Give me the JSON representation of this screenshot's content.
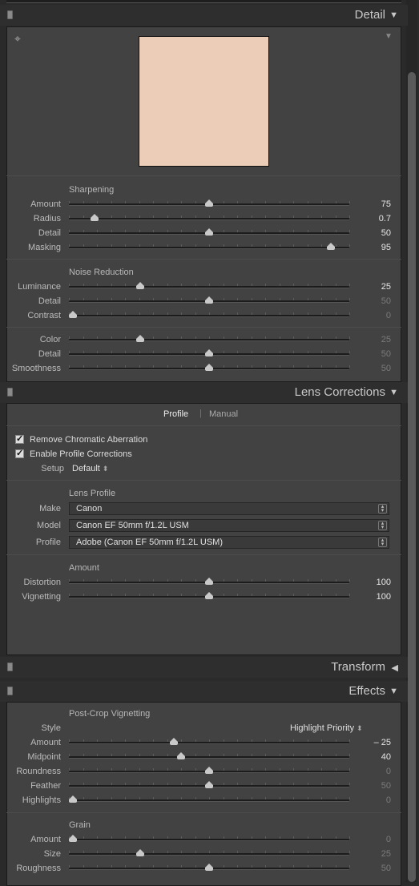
{
  "detail": {
    "title": "Detail",
    "sharpening": {
      "title": "Sharpening",
      "sliders": [
        {
          "label": "Amount",
          "value": "75",
          "pos": 0.5
        },
        {
          "label": "Radius",
          "value": "0.7",
          "pos": 0.09
        },
        {
          "label": "Detail",
          "value": "50",
          "pos": 0.5
        },
        {
          "label": "Masking",
          "value": "95",
          "pos": 0.935
        }
      ]
    },
    "noise": {
      "title": "Noise Reduction",
      "sliders": [
        {
          "label": "Luminance",
          "value": "25",
          "pos": 0.255,
          "dim": false
        },
        {
          "label": "Detail",
          "value": "50",
          "pos": 0.5,
          "dim": true
        },
        {
          "label": "Contrast",
          "value": "0",
          "pos": 0.015,
          "dim": true
        },
        {
          "label": "Color",
          "value": "25",
          "pos": 0.255,
          "dim": true
        },
        {
          "label": "Detail",
          "value": "50",
          "pos": 0.5,
          "dim": true
        },
        {
          "label": "Smoothness",
          "value": "50",
          "pos": 0.5,
          "dim": true
        }
      ]
    }
  },
  "lens": {
    "title": "Lens Corrections",
    "tabs": [
      "Profile",
      "Manual"
    ],
    "remove_ca": "Remove Chromatic Aberration",
    "enable_profile": "Enable Profile Corrections",
    "setup_label": "Setup",
    "setup_value": "Default",
    "profile_title": "Lens Profile",
    "make_label": "Make",
    "make_value": "Canon",
    "model_label": "Model",
    "model_value": "Canon EF 50mm f/1.2L USM",
    "profile_label": "Profile",
    "profile_value": "Adobe (Canon EF 50mm f/1.2L USM)",
    "amount_title": "Amount",
    "sliders": [
      {
        "label": "Distortion",
        "value": "100",
        "pos": 0.5
      },
      {
        "label": "Vignetting",
        "value": "100",
        "pos": 0.5
      }
    ]
  },
  "transform": {
    "title": "Transform"
  },
  "effects": {
    "title": "Effects",
    "vignette_title": "Post-Crop Vignetting",
    "style_label": "Style",
    "style_value": "Highlight Priority",
    "vignette_sliders": [
      {
        "label": "Amount",
        "value": "– 25",
        "pos": 0.375,
        "dim": false
      },
      {
        "label": "Midpoint",
        "value": "40",
        "pos": 0.4,
        "dim": false
      },
      {
        "label": "Roundness",
        "value": "0",
        "pos": 0.5,
        "dim": true
      },
      {
        "label": "Feather",
        "value": "50",
        "pos": 0.5,
        "dim": true
      },
      {
        "label": "Highlights",
        "value": "0",
        "pos": 0.015,
        "dim": true
      }
    ],
    "grain_title": "Grain",
    "grain_sliders": [
      {
        "label": "Amount",
        "value": "0",
        "pos": 0.015,
        "dim": true
      },
      {
        "label": "Size",
        "value": "25",
        "pos": 0.255,
        "dim": true
      },
      {
        "label": "Roughness",
        "value": "50",
        "pos": 0.5,
        "dim": true
      }
    ]
  }
}
